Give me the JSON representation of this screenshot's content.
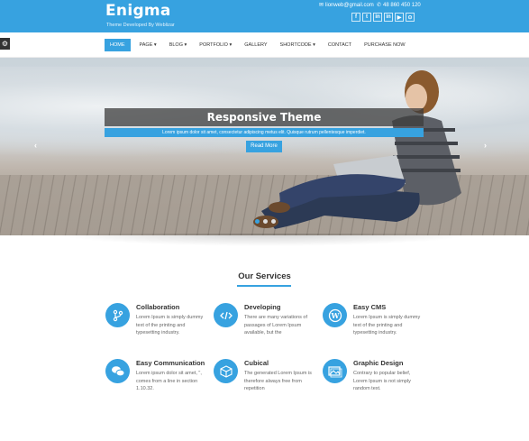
{
  "header": {
    "title": "Enigma",
    "tagline": "Theme Developed By Weblizar",
    "email": "lionweb@gmail.com",
    "phone": "48 860 450 120",
    "social": [
      "f",
      "t",
      "in",
      "in",
      "▶",
      "⊙"
    ]
  },
  "nav": {
    "items": [
      "Home",
      "Page",
      "Blog",
      "Portfolio",
      "Gallery",
      "Shortcode",
      "Contact",
      "Purchase Now"
    ],
    "dropdown_marker": "▾"
  },
  "slider": {
    "title": "Responsive Theme",
    "subtitle": "Lorem ipsum dolor sit amet, consectetur adipiscing metus elit. Quisque rutrum pellentesque imperdiet.",
    "button": "Read More",
    "prev": "‹",
    "next": "›"
  },
  "services": {
    "heading": "Our Services",
    "items": [
      {
        "title": "Collaboration",
        "text": "Lorem Ipsum is simply dummy text of the printing and typesetting industry."
      },
      {
        "title": "Developing",
        "text": "There are many variations of passages of Lorem Ipsum available, but the"
      },
      {
        "title": "Easy CMS",
        "text": "Lorem Ipsum is simply dummy text of the printing and typesetting industry."
      },
      {
        "title": "Easy Communication",
        "text": "Lorem ipsum dolor sit amet, \", comes from a line in section 1.10.32."
      },
      {
        "title": "Cubical",
        "text": "The generated Lorem Ipsum is therefore always free from repetition"
      },
      {
        "title": "Graphic Design",
        "text": "Contrary to popular belief, Lorem Ipsum is not simply random text."
      }
    ]
  },
  "colors": {
    "accent": "#37a2e0"
  }
}
